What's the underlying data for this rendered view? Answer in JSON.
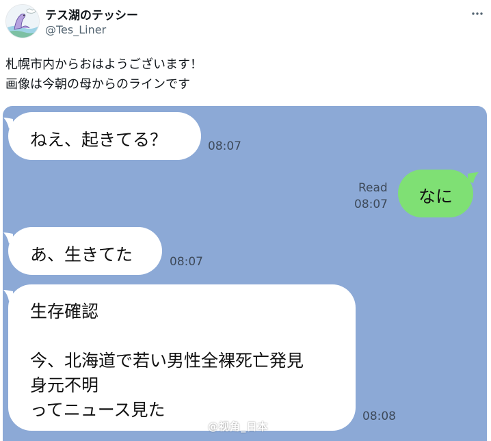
{
  "author": {
    "display_name": "テス湖のテッシー",
    "handle": "@Tes_Liner",
    "avatar_icon": "lake-monster-avatar-icon"
  },
  "more_icon": "more-dots-icon",
  "tweet": {
    "lines": [
      "札幌市内からおはようございます！",
      "画像は今朝の母からのラインです"
    ]
  },
  "chat": {
    "background": "#8ca9d6",
    "incoming_bubble_color": "#ffffff",
    "outgoing_bubble_color": "#7fe074",
    "messages": [
      {
        "direction": "incoming",
        "lines": [
          "ねえ、起きてる？"
        ],
        "time": "08:07"
      },
      {
        "direction": "outgoing",
        "lines": [
          "なに"
        ],
        "read": "Read",
        "time": "08:07"
      },
      {
        "direction": "incoming",
        "lines": [
          "あ、生きてた"
        ],
        "time": "08:07"
      },
      {
        "direction": "incoming",
        "lines": [
          "生存確認",
          "",
          "今、北海道で若い男性全裸死亡発見",
          "身元不明",
          "ってニュース見た"
        ],
        "time": "08:08"
      }
    ],
    "watermark": "@视角_日本"
  }
}
